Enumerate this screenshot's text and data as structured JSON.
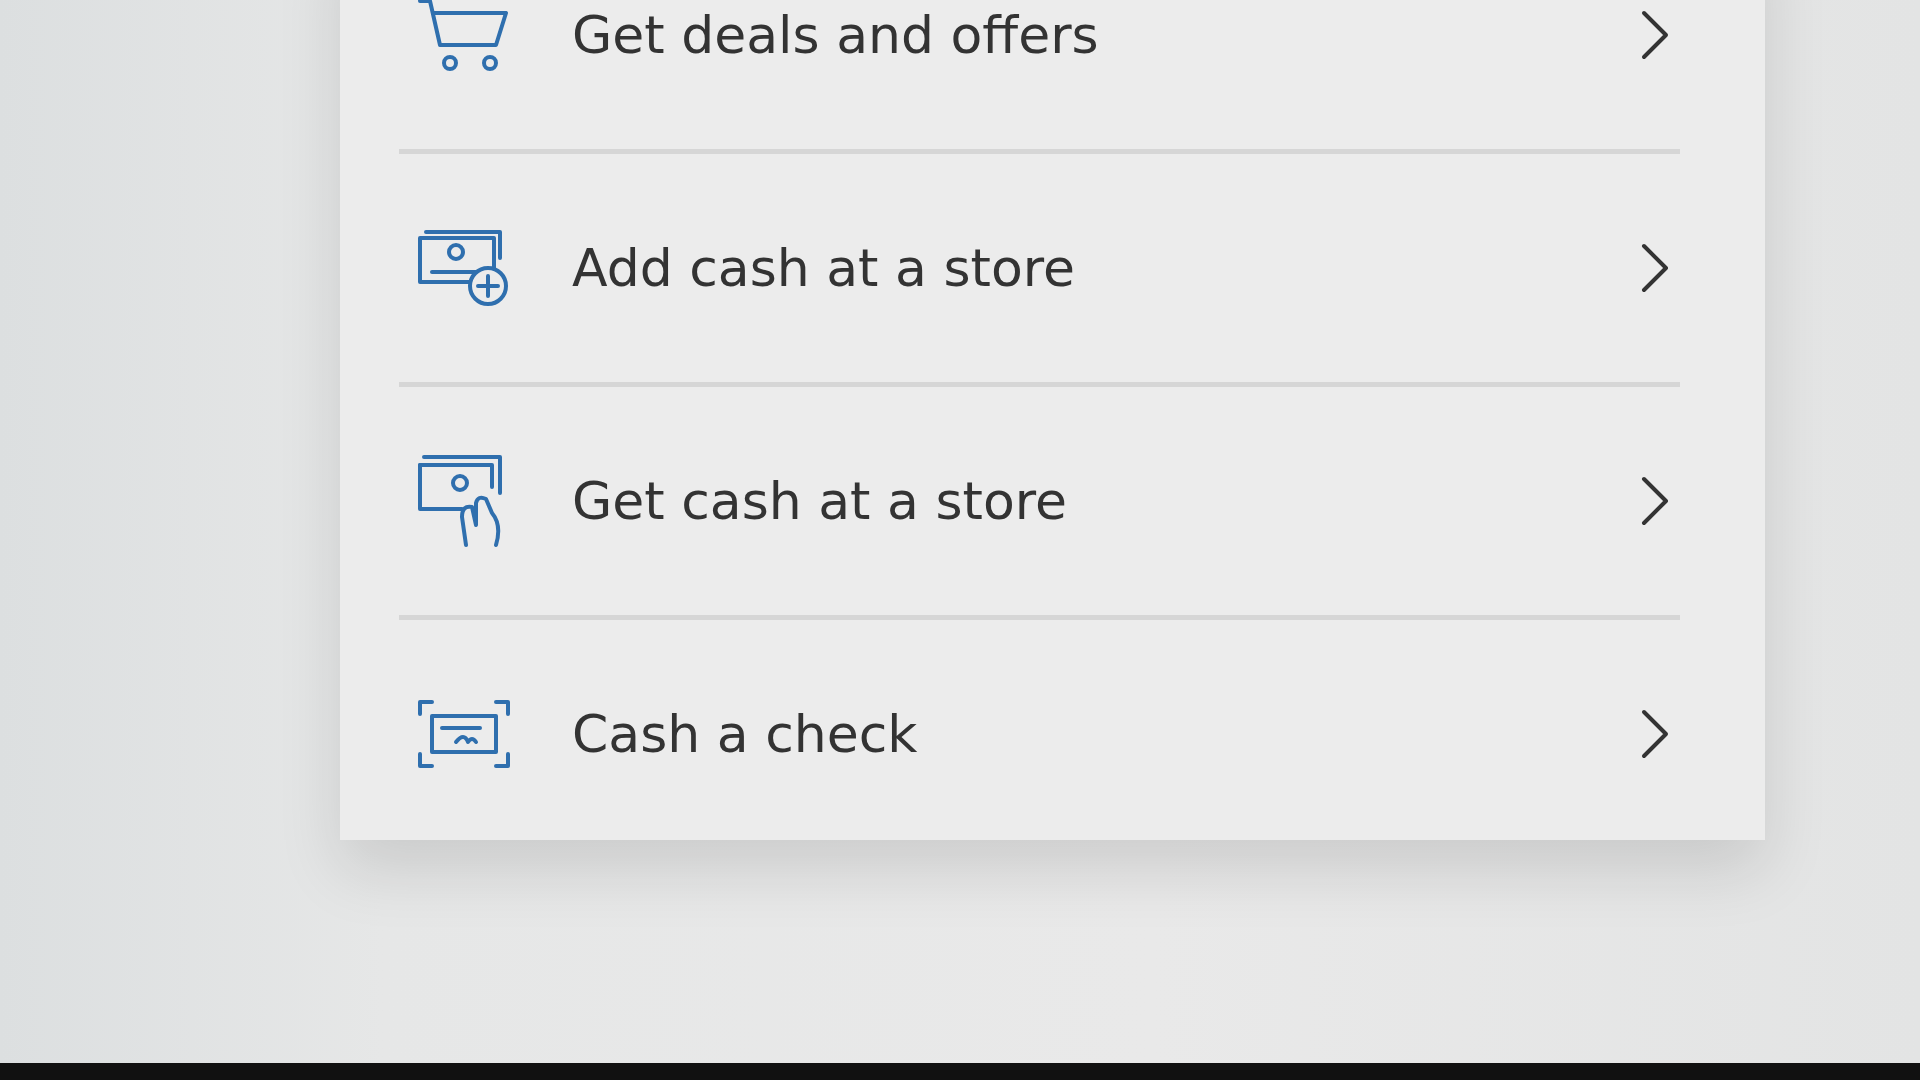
{
  "menu": {
    "items": [
      {
        "label": "Get deals and offers",
        "kind": "cart"
      },
      {
        "label": "Add cash at a store",
        "kind": "add-cash"
      },
      {
        "label": "Get cash at a store",
        "kind": "get-cash"
      },
      {
        "label": "Cash a check",
        "kind": "check"
      }
    ]
  }
}
